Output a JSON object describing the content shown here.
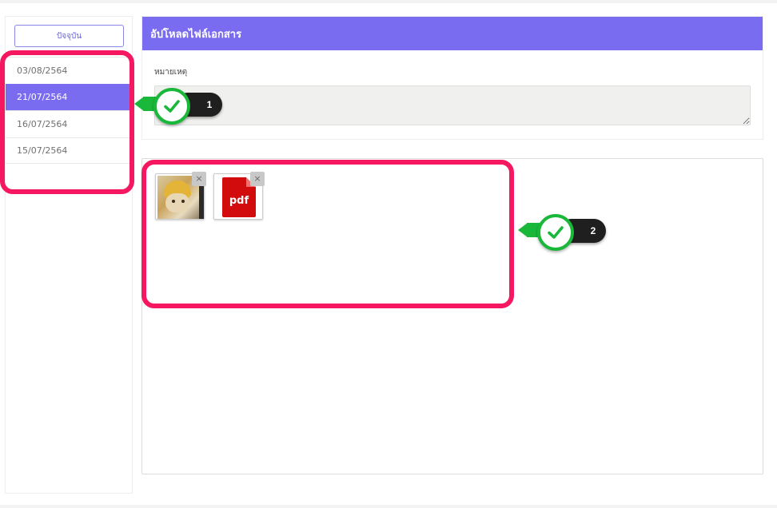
{
  "sidebar": {
    "current_label": "ปัจจุบัน",
    "dates": [
      {
        "label": "03/08/2564",
        "active": false
      },
      {
        "label": "21/07/2564",
        "active": true
      },
      {
        "label": "16/07/2564",
        "active": false
      },
      {
        "label": "15/07/2564",
        "active": false
      }
    ]
  },
  "panel": {
    "title": "อัปโหลดไฟล์เอกสาร",
    "remark_label": "หมายเหตุ",
    "remark_value": ""
  },
  "upload": {
    "files": [
      {
        "type": "image",
        "icon": "image-thumbnail",
        "remove_label": "×"
      },
      {
        "type": "pdf",
        "icon": "pdf-file-icon",
        "label": "pdf",
        "remove_label": "×"
      }
    ]
  },
  "annotations": {
    "markers": [
      {
        "number": "1"
      },
      {
        "number": "2"
      }
    ]
  },
  "colors": {
    "accent": "#7a6cf0",
    "highlight": "#f5175f",
    "marker_green": "#1ab83a",
    "pdf_red": "#d20c0c"
  }
}
